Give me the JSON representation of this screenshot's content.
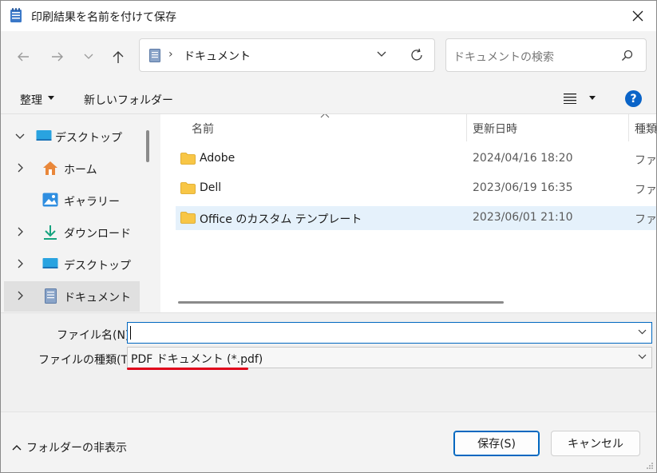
{
  "window": {
    "title": "印刷結果を名前を付けて保存",
    "app_icon": "notepad-icon",
    "close_icon": "close-icon"
  },
  "nav": {
    "back_icon": "arrow-left-icon",
    "forward_icon": "arrow-right-icon",
    "recent_icon": "chevron-down-icon",
    "up_icon": "arrow-up-icon",
    "address": {
      "location_icon": "documents-icon",
      "crumb": "ドキュメント",
      "separator": "›",
      "refresh_icon": "refresh-icon"
    },
    "search": {
      "placeholder": "ドキュメントの検索",
      "icon": "search-icon"
    }
  },
  "command_bar": {
    "organize_label": "整理",
    "new_folder_label": "新しいフォルダー",
    "view_icon": "list-view-icon",
    "help_label": "?"
  },
  "sidebar": {
    "items": [
      {
        "label": "デスクトップ",
        "icon": "desktop-icon",
        "chevron": "expanded",
        "selected": false
      },
      {
        "label": "ホーム",
        "icon": "home-icon",
        "chevron": "collapsed",
        "selected": false
      },
      {
        "label": "ギャラリー",
        "icon": "gallery-icon",
        "chevron": "none",
        "selected": false
      },
      {
        "label": "ダウンロード",
        "icon": "download-icon",
        "chevron": "collapsed",
        "selected": false
      },
      {
        "label": "デスクトップ",
        "icon": "desktop-icon",
        "chevron": "collapsed",
        "selected": false
      },
      {
        "label": "ドキュメント",
        "icon": "documents-icon",
        "chevron": "collapsed",
        "selected": true
      }
    ]
  },
  "file_list": {
    "columns": [
      "名前",
      "更新日時",
      "種類"
    ],
    "rows": [
      {
        "name": "Adobe",
        "modified": "2024/04/16 18:20",
        "type": "ファイ",
        "icon": "folder-icon",
        "highlighted": false
      },
      {
        "name": "Dell",
        "modified": "2023/06/19 16:35",
        "type": "ファイ",
        "icon": "folder-icon",
        "highlighted": false
      },
      {
        "name": "Office のカスタム テンプレート",
        "modified": "2023/06/01 21:10",
        "type": "ファイ",
        "icon": "folder-icon",
        "highlighted": true
      }
    ]
  },
  "form": {
    "filename_label": "ファイル名(N):",
    "filename_value": "",
    "filetype_label": "ファイルの種類(T):",
    "filetype_value": "PDF ドキュメント (*.pdf)"
  },
  "footer": {
    "hide_folders_label": "フォルダーの非表示",
    "save_label": "保存(S)",
    "cancel_label": "キャンセル"
  },
  "colors": {
    "accent": "#0067c0",
    "highlight_row": "#e5f1fb",
    "annotation_red": "#e0001a",
    "folder_yellow": "#f8c646"
  }
}
